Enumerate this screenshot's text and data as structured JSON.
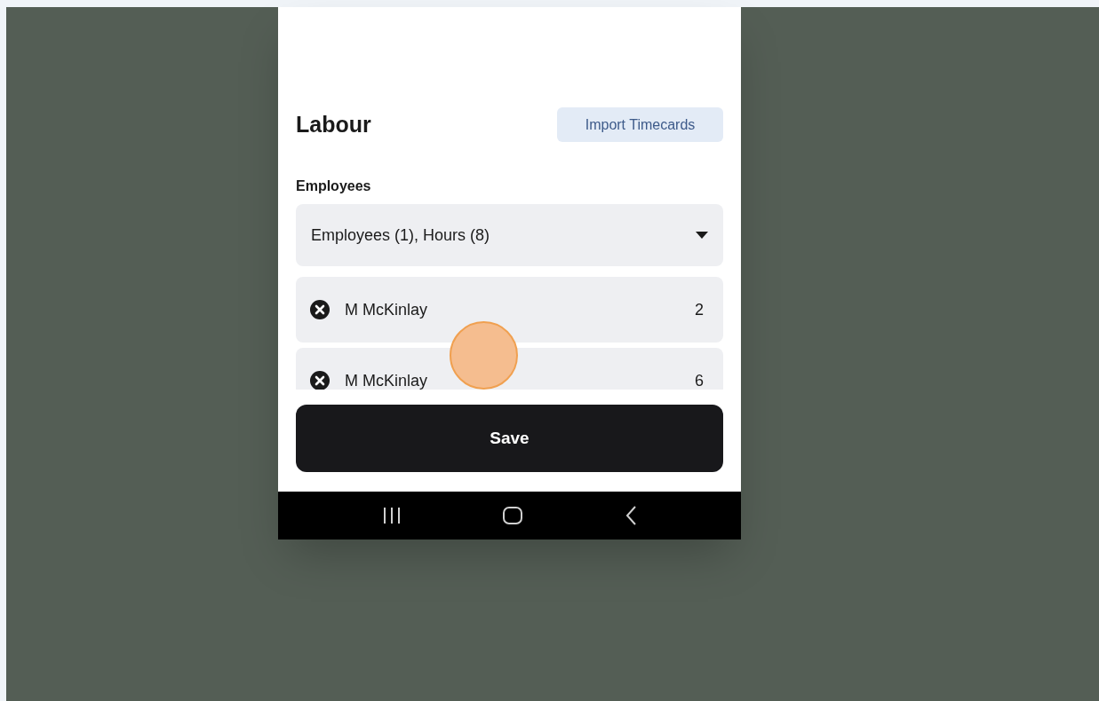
{
  "section": {
    "title": "Labour",
    "import_button": "Import Timecards"
  },
  "employees": {
    "label": "Employees",
    "summary": "Employees (1), Hours (8)",
    "rows": [
      {
        "name": "M McKinlay",
        "hours": "2"
      },
      {
        "name": "M McKinlay",
        "hours": "6"
      }
    ]
  },
  "save_button": "Save"
}
